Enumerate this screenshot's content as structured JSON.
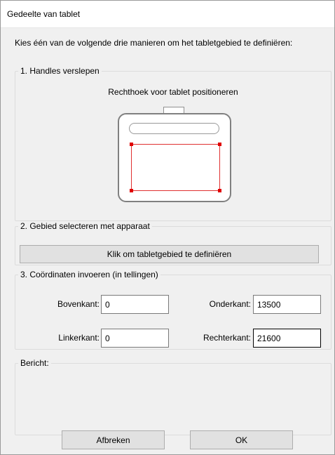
{
  "window": {
    "title": "Gedeelte van tablet"
  },
  "intro_text": "Kies één van de volgende drie manieren om het tabletgebied te definiëren:",
  "section1": {
    "legend": "1. Handles verslepen",
    "caption": "Rechthoek voor tablet positioneren"
  },
  "section2": {
    "legend": "2. Gebied selecteren met apparaat",
    "button_label": "Klik om tabletgebied te definiëren"
  },
  "section3": {
    "legend": "3. Coördinaten invoeren (in tellingen)",
    "top_label": "Bovenkant:",
    "top_value": "0",
    "bottom_label": "Onderkant:",
    "bottom_value": "13500",
    "left_label": "Linkerkant:",
    "left_value": "0",
    "right_label": "Rechterkant:",
    "right_value": "21600"
  },
  "section4": {
    "legend": "Bericht:",
    "message": ""
  },
  "buttons": {
    "cancel": "Afbreken",
    "ok": "OK"
  },
  "colors": {
    "handle": "#e00000",
    "area_border": "#e03030",
    "dialog_bg": "#f0f0f0"
  }
}
